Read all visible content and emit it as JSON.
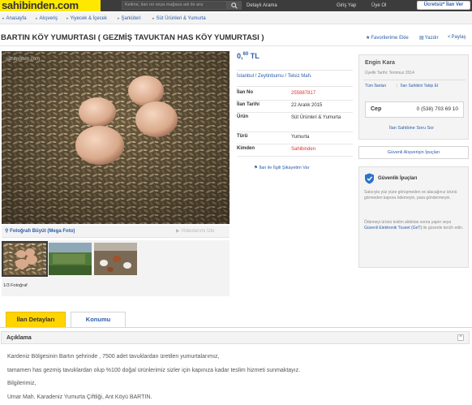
{
  "header": {
    "logo": "sahibinden.com",
    "search_placeholder": "Kelime, ilan no veya mağaza adı ile ara",
    "advanced_search": "Detaylı Arama",
    "login": "Giriş Yap",
    "signup": "Üye Ol",
    "post_ad": "Ücretsiz* İlan Ver"
  },
  "breadcrumb": [
    "Anasayfa",
    "Alışveriş",
    "Yiyecek & İçecek",
    "Şarküteri",
    "Süt Ürünleri & Yumurta"
  ],
  "listing": {
    "title": "BARTIN KÖY YUMURTASI ( GEZMİŞ TAVUKTAN HAS KÖY YUMURTASI )",
    "favorites": "Favorilerime Ekle",
    "print": "Yazdır",
    "share": "Paylaş",
    "price_main": "0,",
    "price_cents": "60",
    "price_currency": "TL",
    "location": "İstanbul / Zeytinburnu / Telsiz Mah.",
    "details": [
      {
        "label": "İlan No",
        "value": "255887817",
        "color": "red"
      },
      {
        "label": "İlan Tarihi",
        "value": "22 Aralık 2015",
        "color": ""
      },
      {
        "label": "Ürün",
        "value": "Süt Ürünleri & Yumurta",
        "color": ""
      },
      {
        "label": "Türü",
        "value": "Yumurta",
        "color": ""
      },
      {
        "label": "Kimden",
        "value": "Sahibinden",
        "color": "red"
      }
    ],
    "report": "İlan ile İlgili Şikayetim Var"
  },
  "gallery": {
    "watermark": "sahibinden.com",
    "enlarge": "Fotoğrafı Büyüt (Mega Foto)",
    "video": "Videolarımı İzle",
    "count": "1/3 Fotoğraf"
  },
  "seller": {
    "name": "Engin Kara",
    "member_since": "Üyelik Tarihi: Temmuz 2014",
    "all_ads": "Tüm İlanları",
    "follow": "İlan Sahibini Takip Et",
    "phone_label": "Cep",
    "phone": "0 (538) 703 69 10",
    "ask": "İlan Sahibine Soru Sor"
  },
  "safety": {
    "tips_button": "Güvenli Alışverişin İpuçları",
    "title": "Güvenlik İpuçları",
    "p1": "Satıcıyla yüz yüze görüşmeden ve alacağınız ürünü görmeden kapora ödemeyin, para göndermeyin.",
    "p2_prefix": "Ödemeyi ürünü teslim aldıktan sonra yapın veya ",
    "p2_link": "Güvenli Elektronik Ticaret (GeT)",
    "p2_suffix": " ile güvenle tercih edin."
  },
  "tabs": {
    "details": "İlan Detayları",
    "location": "Konumu"
  },
  "description": {
    "title": "Açıklama",
    "lines": [
      "Kardeniz Bölgesinin Bartın şehrinde , 7500 adet tavuklardan üretilen yumurtalarımız,",
      "tamamen has gezmiş tavuklardan olup %100 doğal ürünlerimiz sizler için kapınıza kadar teslim hizmeti sunmaktayız.",
      "Bilgilerimiz,",
      "Umar Mah. Karadeniz Yumurta Çiftliği, Ant Köyü BARTIN."
    ]
  },
  "colors": {
    "brand_yellow": "#ffe800",
    "link_blue": "#2b5ca8",
    "accent_red": "#e03131",
    "topbar": "#3c3c3c"
  }
}
